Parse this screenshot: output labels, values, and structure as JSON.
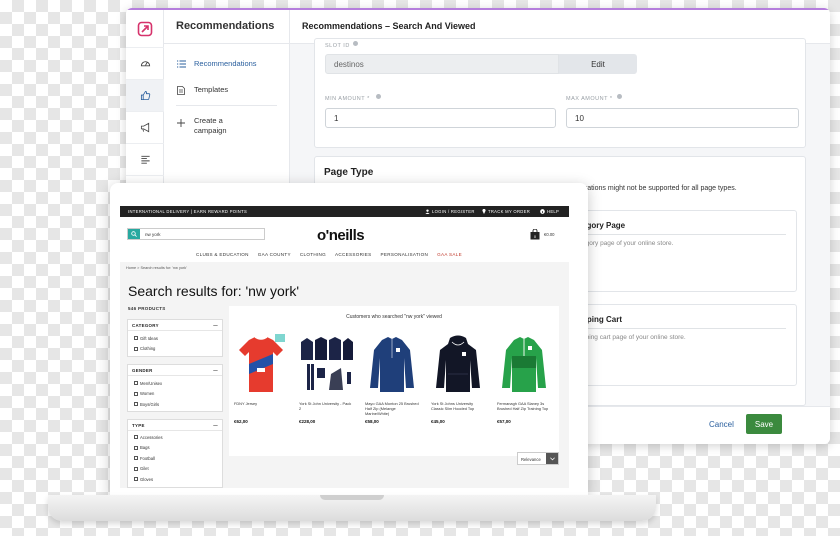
{
  "admin": {
    "sidebar": {
      "title": "Recommendations",
      "items": [
        {
          "label": "Recommendations",
          "icon": "list-icon"
        },
        {
          "label": "Templates",
          "icon": "document-icon"
        },
        {
          "label": "Create a campaign",
          "icon": "plus-icon"
        }
      ]
    },
    "rail_icons": [
      "logo-icon",
      "dashboard-icon",
      "thumbs-up-icon",
      "megaphone-icon",
      "align-icon",
      "mail-icon"
    ],
    "header_title": "Recommendations – Search And Viewed",
    "slot_id": {
      "label": "SLOT ID",
      "value": "destinos",
      "edit_label": "Edit"
    },
    "min_amount": {
      "label": "MIN AMOUNT *",
      "value": "1"
    },
    "max_amount": {
      "label": "MAX AMOUNT *",
      "value": "10"
    },
    "page_type": {
      "title": "Page Type",
      "note": "urations might not be supported for all page types.",
      "options": [
        {
          "title": "egory Page",
          "desc": "egory page of your online store."
        },
        {
          "title": "pping Cart",
          "desc": "pping cart page of your online store."
        }
      ]
    },
    "footer": {
      "cancel_label": "Cancel",
      "save_label": "Save"
    },
    "colors": {
      "accent": "#b57edc",
      "save": "#3b8a3e",
      "link": "#2a5f9e"
    }
  },
  "shop": {
    "topbar": {
      "promo": "INTERNATIONAL DELIVERY | EARN REWARD POINTS",
      "login": "LOGIN / REGISTER",
      "track": "TRACK MY ORDER",
      "help": "HELP"
    },
    "search_value": "nw york",
    "logo": "o'neills",
    "cart_total": "€0.00",
    "nav": [
      "CLUBS & EDUCATION",
      "GAA COUNTY",
      "CLOTHING",
      "ACCESSORIES",
      "PERSONALISATION",
      "GAA SALE"
    ],
    "breadcrumb": "Home > Search results for: 'nw york'",
    "results_title": "Search results for: 'nw york'",
    "product_count": "546 PRODUCTS",
    "filters": [
      {
        "title": "CATEGORY",
        "options": [
          "Gift Ideas",
          "Clothing"
        ]
      },
      {
        "title": "GENDER",
        "options": [
          "Men/Unisex",
          "Women",
          "Boys/Girls"
        ]
      },
      {
        "title": "TYPE",
        "options": [
          "Accessories",
          "Bags",
          "Football",
          "Gilet",
          "Gloves"
        ]
      }
    ],
    "panel_title": "Customers who searched \"nw york\" viewed",
    "products": [
      {
        "name": "FDNY Jersey",
        "price": "€62,00"
      },
      {
        "name": "York St John University - Pack 2",
        "price": "€228,00"
      },
      {
        "name": "Mayo GAA Monton 25 Brushed Half Zip (Melange Marine/White)",
        "price": "€58,00"
      },
      {
        "name": "York St Johns University Classic Slim Hooded Top",
        "price": "€45,00"
      },
      {
        "name": "Fermanagh GAA Slaney 3s Brushed Half Zip Training Top",
        "price": "€57,00"
      }
    ],
    "sort_label": "Relevance",
    "colors": {
      "search_button": "#28a9a0",
      "sale": "#c0392b"
    }
  }
}
